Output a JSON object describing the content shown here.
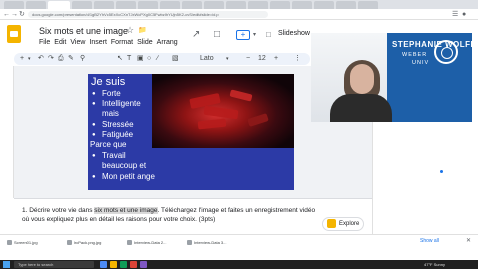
{
  "browser": {
    "url": "docs.google.com/presentation/d/1gB2YhVc5ExXcCXnTJxWcPXg0C5FwbzIhYUjn5K2-cvS/edit#slide=id.p",
    "tab_count": 17
  },
  "app": {
    "title": "Six mots et une image",
    "menu": [
      "File",
      "Edit",
      "View",
      "Insert",
      "Format",
      "Slide",
      "Arrang"
    ],
    "slideshow_label": "Slideshow"
  },
  "toolbar": {
    "font": "Lato",
    "font_size": "12"
  },
  "slide": {
    "heading": "Je suis",
    "lines": [
      {
        "text": "Forte",
        "bullet": true,
        "indent": 1
      },
      {
        "text": "Intelligente",
        "bullet": true,
        "indent": 1
      },
      {
        "text": "mais",
        "bullet": false,
        "indent": 1
      },
      {
        "text": "Stressée",
        "bullet": true,
        "indent": 1
      },
      {
        "text": "Fatiguée",
        "bullet": true,
        "indent": 1
      },
      {
        "text": "Parce que",
        "bullet": false,
        "indent": 0
      },
      {
        "text": "Travail",
        "bullet": true,
        "indent": 1
      },
      {
        "text": "beaucoup et",
        "bullet": false,
        "indent": 1
      },
      {
        "text": "Mon petit ange",
        "bullet": true,
        "indent": 1
      }
    ]
  },
  "notes": {
    "before": "1. Décrire votre vie dans ",
    "highlight1": "six mots et une image",
    "after": ". Téléchargez l'image et faites un enregistrement vidéo où vous expliquez plus en détail les raisons pour votre choix. (3pts)"
  },
  "explore": {
    "label": "Explore"
  },
  "webcam": {
    "name": "STEPHANIE WOLFE",
    "sub1": "WEBER",
    "sub2": "UNIV"
  },
  "downloads": {
    "items": [
      "Screen01.jpg",
      "lrcPack.png.jpg",
      "Interview-Data 2...",
      "Interview-Data 3..."
    ],
    "show_all": "Show all"
  },
  "taskbar": {
    "search_placeholder": "Type here to search",
    "tray": "47°F  Sunny"
  },
  "colors": {
    "slide_bg": "#2c3aa6",
    "webcam_bg": "#1d5fa8",
    "slides_brand": "#f4b400",
    "toolbar_bg": "#edf2fa"
  }
}
